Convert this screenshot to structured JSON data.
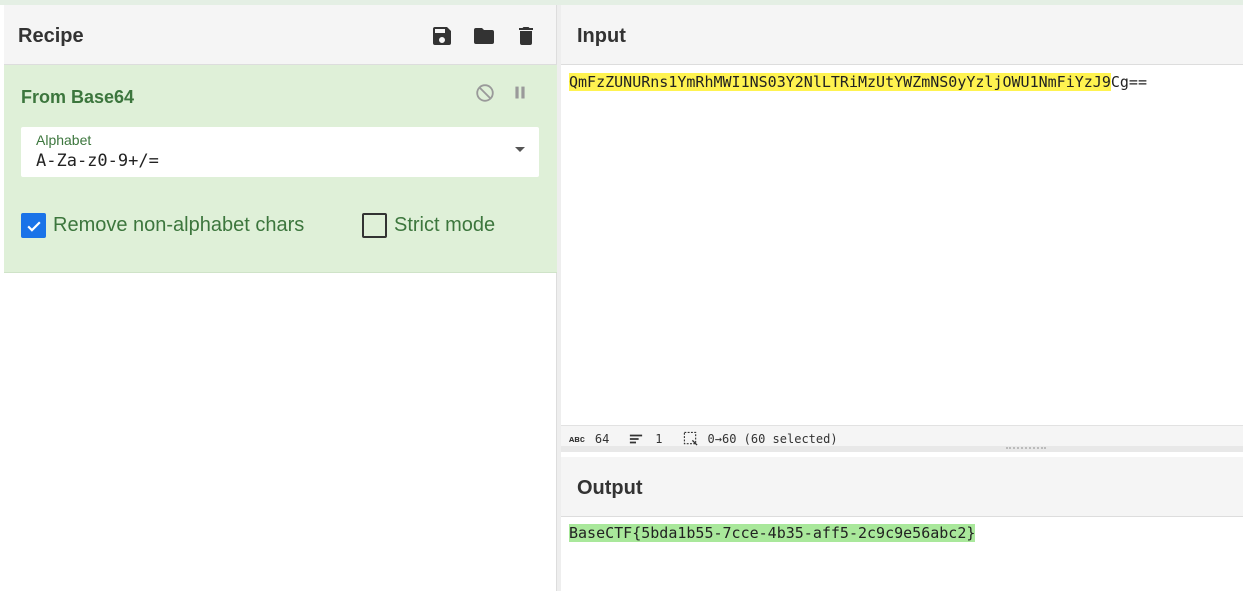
{
  "recipe": {
    "title": "Recipe",
    "icons": [
      "save-icon",
      "open-folder-icon",
      "trash-icon"
    ],
    "operation": {
      "name": "From Base64",
      "icons": [
        "disable-icon",
        "pause-icon"
      ],
      "alphabet": {
        "label": "Alphabet",
        "value": "A-Za-z0-9+/="
      },
      "remove_non_alphabet": {
        "label": "Remove non-alphabet chars",
        "checked": true
      },
      "strict_mode": {
        "label": "Strict mode",
        "checked": false
      }
    }
  },
  "input": {
    "title": "Input",
    "text_selected": "QmFzZUNURns1YmRhMWI1NS03Y2NlLTRiMzUtYWZmNS0yYzljOWU1NmFiYzJ9",
    "text_rest": "Cg==",
    "status": {
      "length_icon": "abc-icon",
      "length": "64",
      "lines": "1",
      "selection": "0→60 (60 selected)"
    }
  },
  "output": {
    "title": "Output",
    "text": "BaseCTF{5bda1b55-7cce-4b35-aff5-2c9c9e56abc2}"
  },
  "colors": {
    "recipe_bg": "#dff0d8",
    "recipe_text": "#3c763d",
    "input_highlight": "#fff350",
    "output_highlight": "#a9e89b",
    "checkbox": "#1a73e8"
  }
}
